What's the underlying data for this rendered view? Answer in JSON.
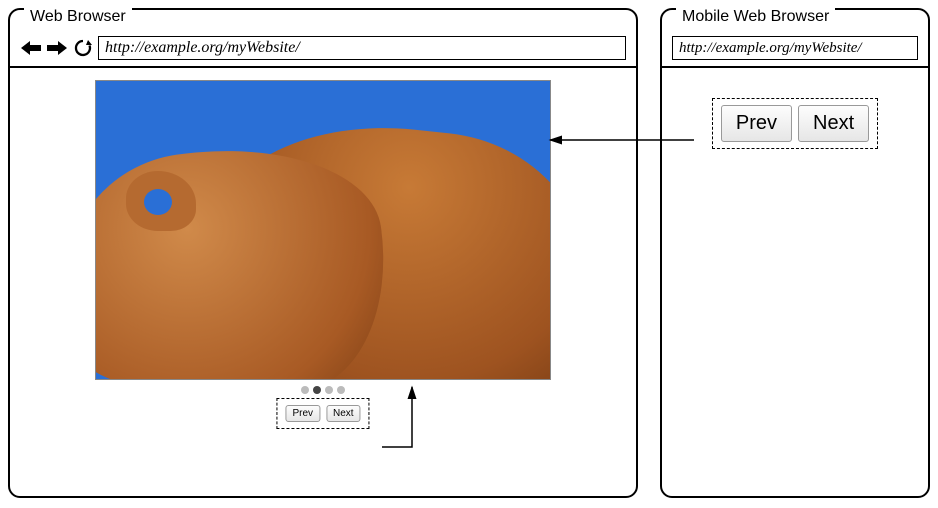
{
  "web": {
    "title": "Web Browser",
    "url": "http://example.org/myWebsite/",
    "buttons": {
      "prev": "Prev",
      "next": "Next"
    },
    "carousel": {
      "dot_count": 4,
      "active_index": 1
    }
  },
  "mobile": {
    "title": "Mobile Web Browser",
    "url": "http://example.org/myWebsite/",
    "buttons": {
      "prev": "Prev",
      "next": "Next"
    }
  }
}
